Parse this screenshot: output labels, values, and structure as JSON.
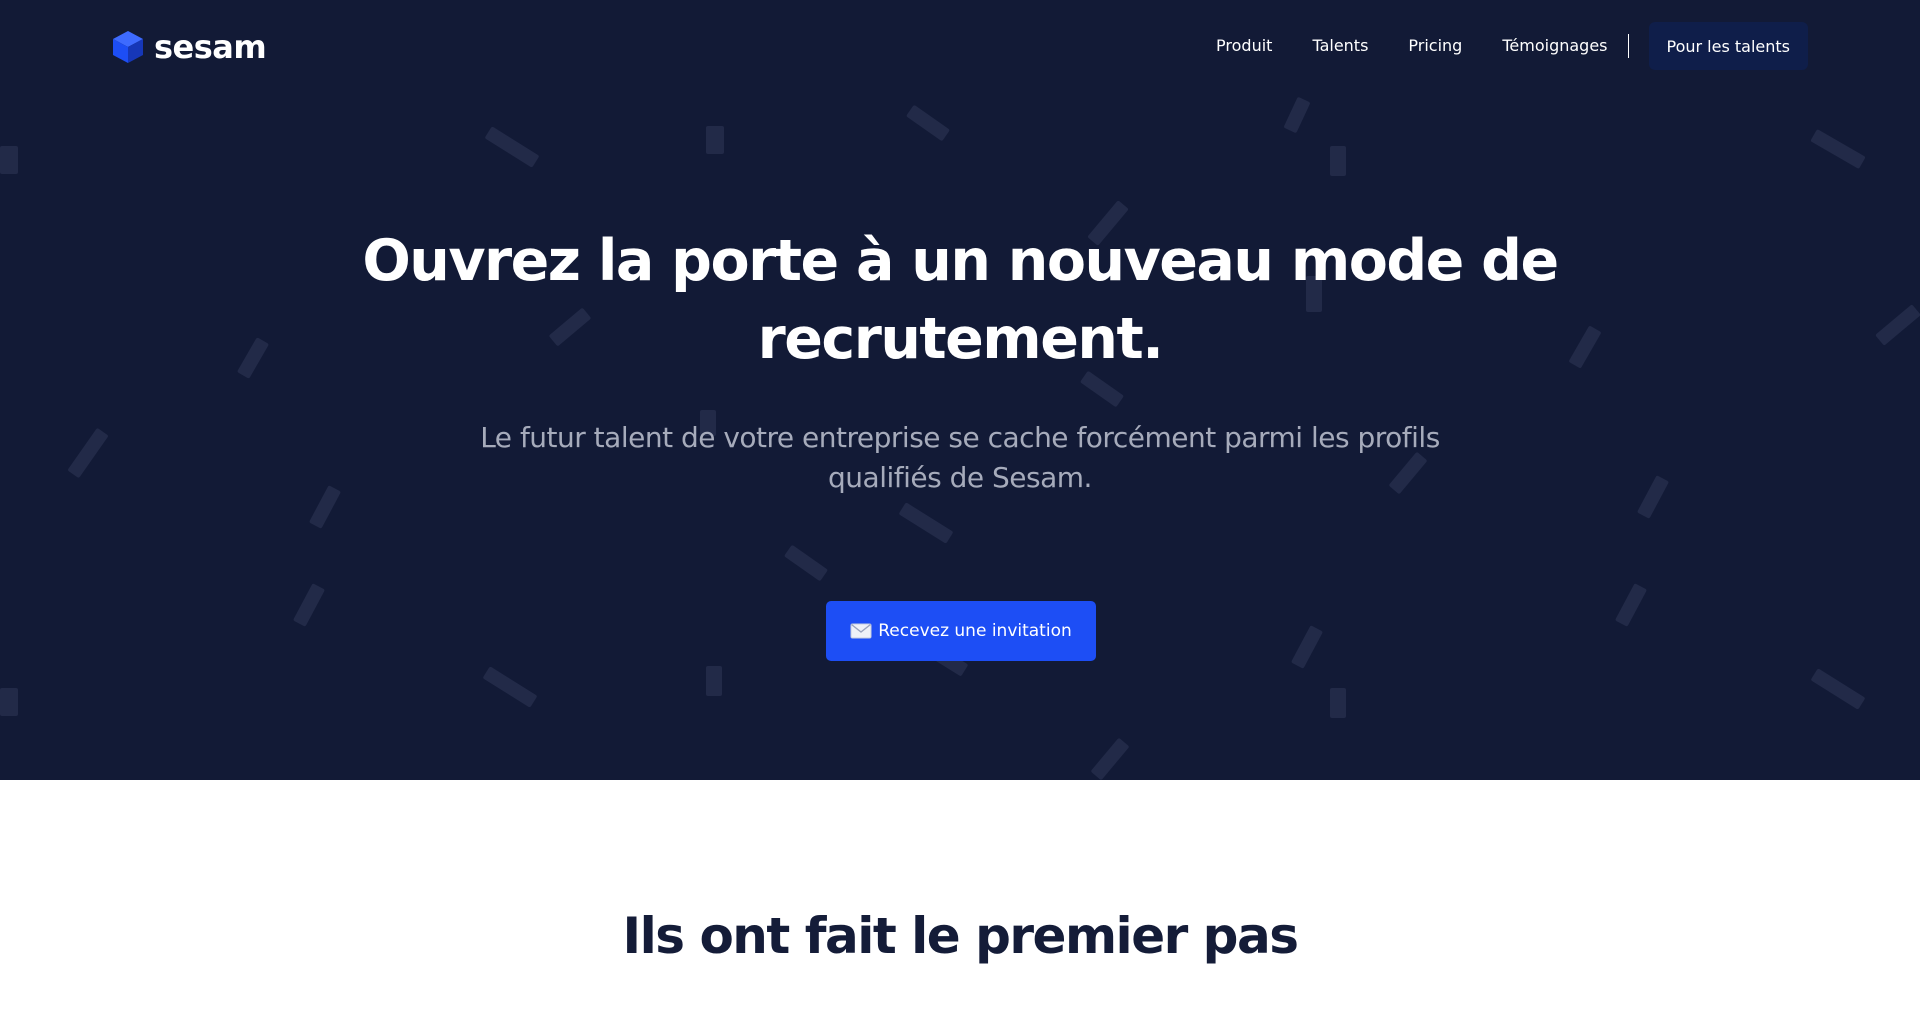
{
  "header": {
    "brand": "sesam",
    "nav": [
      {
        "label": "Produit"
      },
      {
        "label": "Talents"
      },
      {
        "label": "Pricing"
      },
      {
        "label": "Témoignages"
      }
    ],
    "cta_label": "Pour les talents"
  },
  "hero": {
    "title_line1": "Ouvrez la porte à un nouveau mode de",
    "title_line2": "recrutement.",
    "subtitle_line1": "Le futur talent de votre entreprise se cache forcément parmi les profils",
    "subtitle_line2": "qualifiés de Sesam.",
    "cta_label": "Recevez une invitation",
    "cta_icon": "envelope-icon"
  },
  "logos_section": {
    "title": "Ils ont fait le premier pas"
  },
  "colors": {
    "hero_background": "#121a36",
    "accent": "#1d4ef5",
    "nav_cta_background": "#0f1e4a",
    "subtitle_text": "#a6abbb",
    "section_title_text": "#141c38"
  }
}
